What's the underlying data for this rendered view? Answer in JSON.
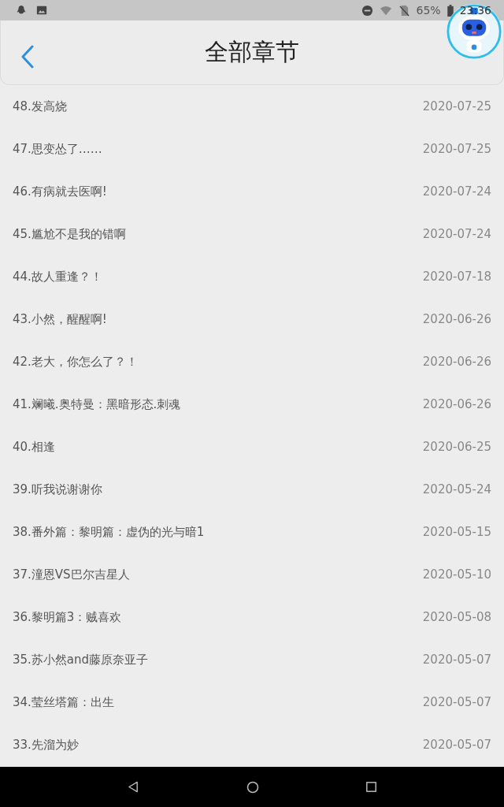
{
  "status_bar": {
    "battery_text": "65%",
    "time": "23:36"
  },
  "header": {
    "title": "全部章节"
  },
  "chapters": [
    {
      "title": "48.发高烧",
      "date": "2020-07-25"
    },
    {
      "title": "47.思变怂了……",
      "date": "2020-07-25"
    },
    {
      "title": "46.有病就去医啊!",
      "date": "2020-07-24"
    },
    {
      "title": "45.尴尬不是我的错啊",
      "date": "2020-07-24"
    },
    {
      "title": "44.故人重逢？！",
      "date": "2020-07-18"
    },
    {
      "title": "43.小然，醒醒啊!",
      "date": "2020-06-26"
    },
    {
      "title": "42.老大，你怎么了？！",
      "date": "2020-06-26"
    },
    {
      "title": "41.斓曦.奥特曼：黑暗形态.刺魂",
      "date": "2020-06-26"
    },
    {
      "title": "40.相逢",
      "date": "2020-06-25"
    },
    {
      "title": "39.听我说谢谢你",
      "date": "2020-05-24"
    },
    {
      "title": "38.番外篇：黎明篇：虚伪的光与暗1",
      "date": "2020-05-15"
    },
    {
      "title": "37.潼恩VS巴尔吉星人",
      "date": "2020-05-10"
    },
    {
      "title": "36.黎明篇3：贼喜欢",
      "date": "2020-05-08"
    },
    {
      "title": "35.苏小然and藤原奈亚子",
      "date": "2020-05-07"
    },
    {
      "title": "34.莹丝塔篇：出生",
      "date": "2020-05-07"
    },
    {
      "title": "33.先溜为妙",
      "date": "2020-05-07"
    }
  ]
}
